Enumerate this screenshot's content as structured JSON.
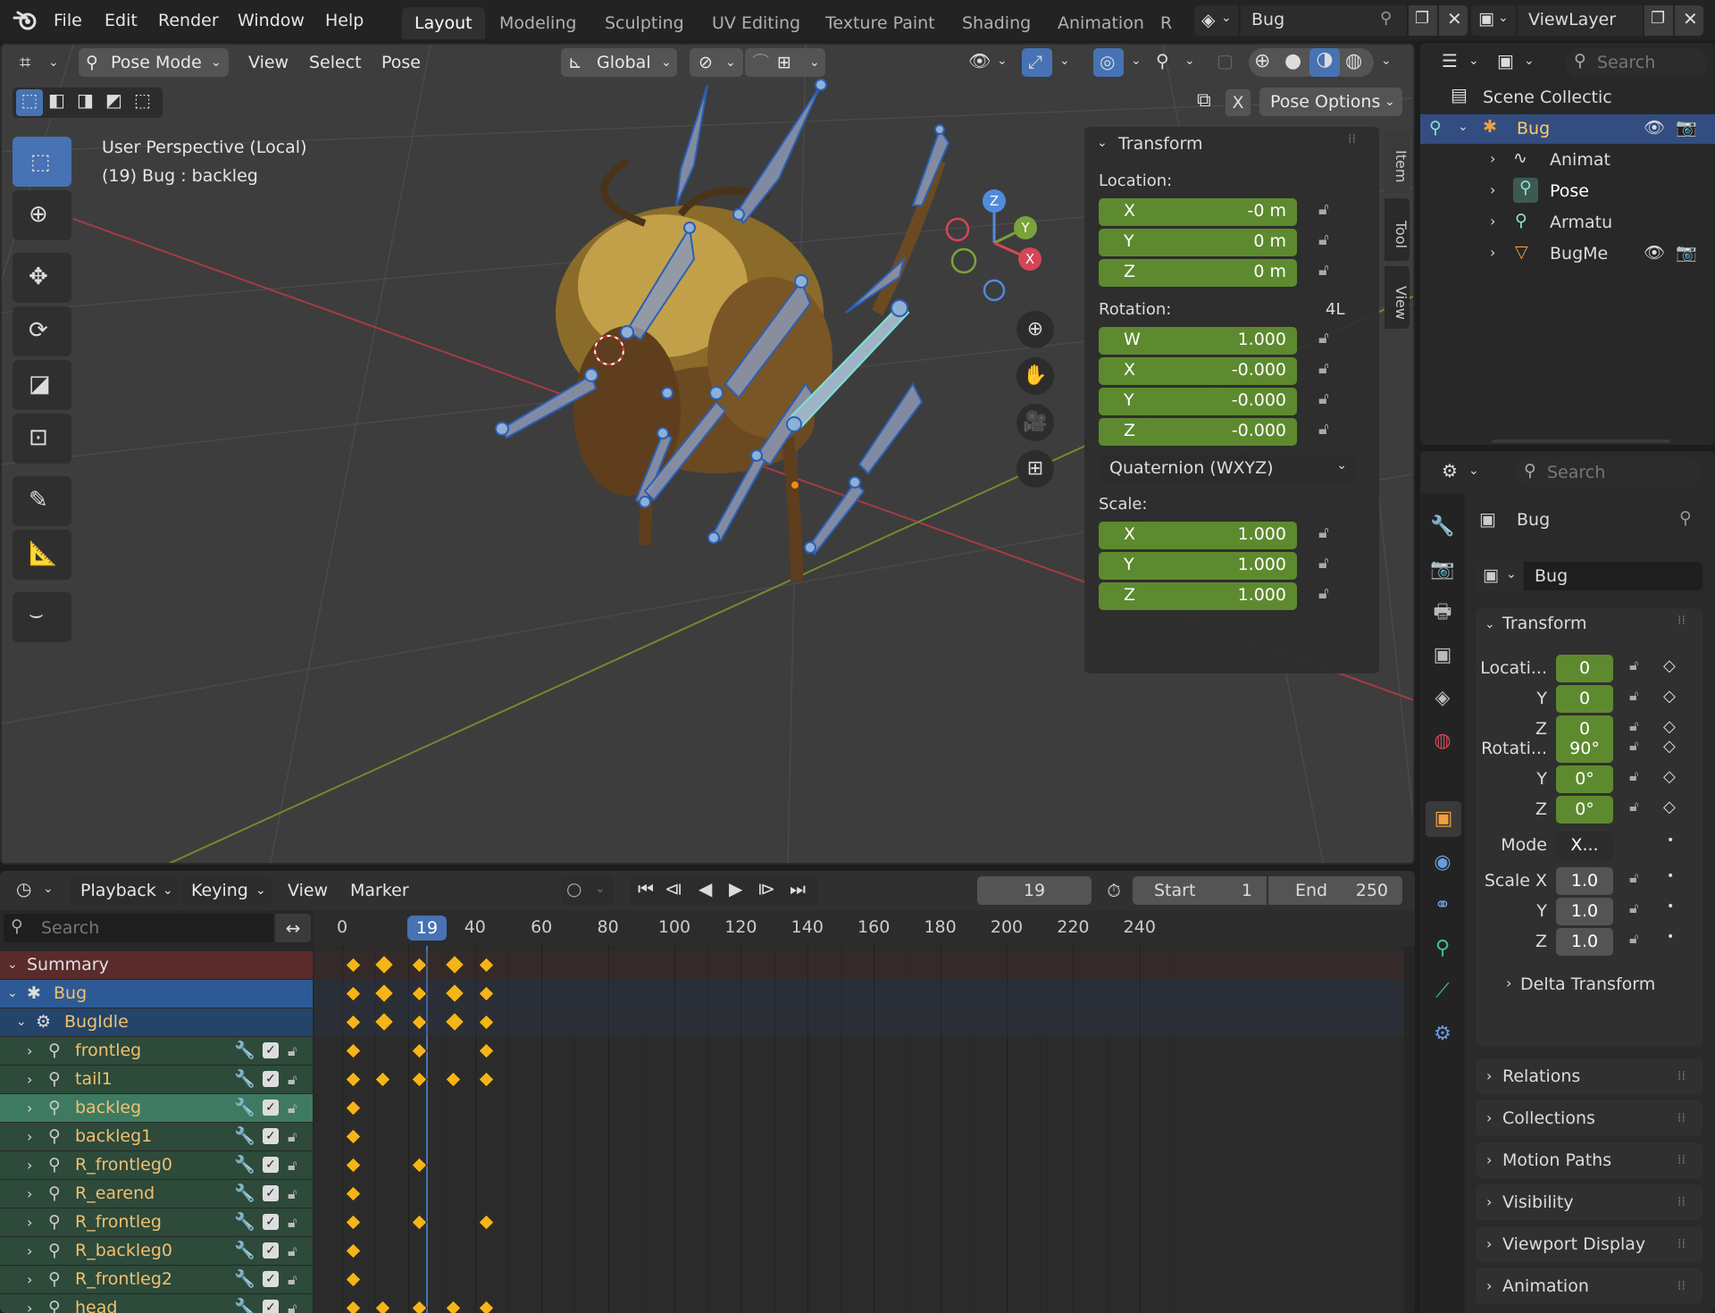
{
  "topbar": {
    "menus": [
      "File",
      "Edit",
      "Render",
      "Window",
      "Help"
    ],
    "workspaces": [
      "Layout",
      "Modeling",
      "Sculpting",
      "UV Editing",
      "Texture Paint",
      "Shading",
      "Animation",
      "R"
    ],
    "active_workspace": "Layout",
    "scene_name": "Bug",
    "view_layer": "ViewLayer"
  },
  "viewport": {
    "mode": "Pose Mode",
    "menus": [
      "View",
      "Select",
      "Pose"
    ],
    "transform_orientation": "Global",
    "info_line1": "User Perspective (Local)",
    "info_line2": "(19) Bug : backleg",
    "pose_options": "Pose Options",
    "gizmo_axes": {
      "z": "Z",
      "y": "Y",
      "x": "X"
    },
    "tabs": [
      "Item",
      "Tool",
      "View"
    ],
    "npanel": {
      "title": "Transform",
      "location_label": "Location:",
      "location": [
        {
          "axis": "X",
          "value": "-0 m"
        },
        {
          "axis": "Y",
          "value": "0 m"
        },
        {
          "axis": "Z",
          "value": "0 m"
        }
      ],
      "rotation_label": "Rotation:",
      "rotation_mode_badge": "4L",
      "rotation": [
        {
          "axis": "W",
          "value": "1.000"
        },
        {
          "axis": "X",
          "value": "-0.000"
        },
        {
          "axis": "Y",
          "value": "-0.000"
        },
        {
          "axis": "Z",
          "value": "-0.000"
        }
      ],
      "rotation_mode": "Quaternion (WXYZ)",
      "scale_label": "Scale:",
      "scale": [
        {
          "axis": "X",
          "value": "1.000"
        },
        {
          "axis": "Y",
          "value": "1.000"
        },
        {
          "axis": "Z",
          "value": "1.000"
        }
      ]
    }
  },
  "outliner": {
    "search_placeholder": "Search",
    "scene_collection": "Scene Collectic",
    "items": [
      {
        "label": "Bug",
        "depth": 0,
        "selected": true
      },
      {
        "label": "Animat",
        "depth": 1
      },
      {
        "label": "Pose",
        "depth": 1
      },
      {
        "label": "Armatu",
        "depth": 1
      },
      {
        "label": "BugMe",
        "depth": 1
      }
    ]
  },
  "properties": {
    "search_placeholder": "Search",
    "object_name": "Bug",
    "object_field": "Bug",
    "transform_title": "Transform",
    "location_label": "Locati...",
    "location": [
      "0",
      "0",
      "0"
    ],
    "rotation_label": "Rotati...",
    "rotation": [
      "90°",
      "0°",
      "0°"
    ],
    "axis_labels": [
      "Y",
      "Z"
    ],
    "mode_label": "Mode",
    "mode_value": "X...",
    "scale_label": "Scale X",
    "scale": [
      "1.0",
      "1.0",
      "1.0"
    ],
    "delta_transform": "Delta Transform",
    "sections": [
      "Relations",
      "Collections",
      "Motion Paths",
      "Visibility",
      "Viewport Display",
      "Animation"
    ]
  },
  "timeline": {
    "menus": [
      "Playback",
      "Keying",
      "View",
      "Marker"
    ],
    "current_frame": "19",
    "start_label": "Start",
    "start": "1",
    "end_label": "End",
    "end": "250",
    "search_placeholder": "Search",
    "ruler": [
      "0",
      "19",
      "40",
      "60",
      "80",
      "100",
      "120",
      "140",
      "160",
      "180",
      "200",
      "220",
      "240"
    ],
    "channels": [
      {
        "label": "Summary",
        "kind": "summary",
        "keys": [
          0,
          9,
          20,
          30,
          40
        ]
      },
      {
        "label": "Bug",
        "kind": "object",
        "keys": [
          0,
          9,
          20,
          30,
          40
        ]
      },
      {
        "label": "BugIdle",
        "kind": "action",
        "keys": [
          0,
          9,
          20,
          30,
          40
        ]
      },
      {
        "label": "frontleg",
        "kind": "bone",
        "keys": [
          0,
          20,
          40
        ]
      },
      {
        "label": "tail1",
        "kind": "bone",
        "keys": [
          0,
          9,
          20,
          30,
          40
        ]
      },
      {
        "label": "backleg",
        "kind": "bone-sel",
        "keys": [
          0
        ]
      },
      {
        "label": "backleg1",
        "kind": "bone",
        "keys": [
          0
        ]
      },
      {
        "label": "R_frontleg0",
        "kind": "bone",
        "keys": [
          0,
          20
        ]
      },
      {
        "label": "R_earend",
        "kind": "bone",
        "keys": [
          0
        ]
      },
      {
        "label": "R_frontleg",
        "kind": "bone",
        "keys": [
          0,
          20,
          40
        ]
      },
      {
        "label": "R_backleg0",
        "kind": "bone",
        "keys": [
          0
        ]
      },
      {
        "label": "R_frontleg2",
        "kind": "bone",
        "keys": [
          0
        ]
      },
      {
        "label": "head",
        "kind": "bone",
        "keys": [
          0,
          9,
          20,
          30,
          40
        ]
      }
    ]
  }
}
